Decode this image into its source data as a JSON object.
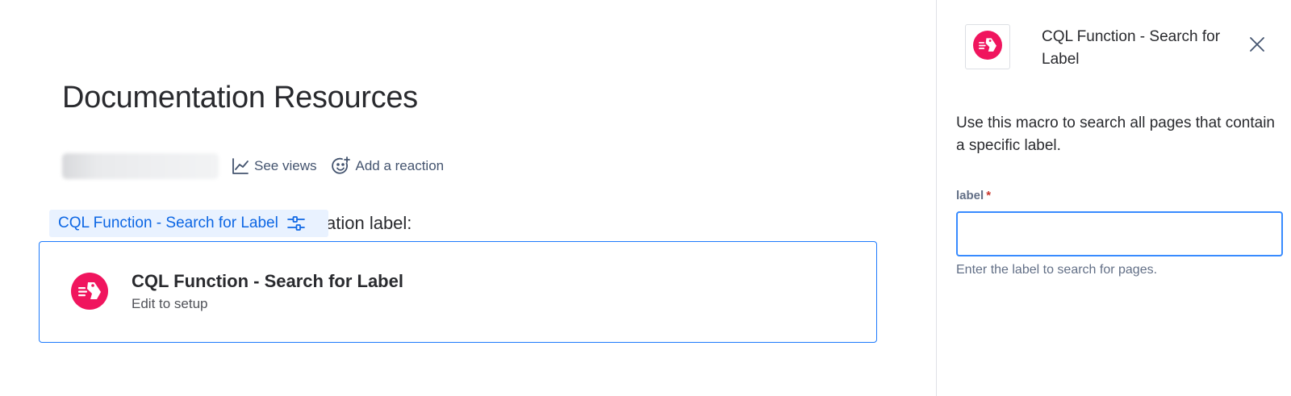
{
  "page": {
    "title": "Documentation Resources",
    "see_views_label": "See views",
    "add_reaction_label": "Add a reaction",
    "text_tail": "ation label:"
  },
  "macro_chip": {
    "label": "CQL Function - Search for Label"
  },
  "macro_card": {
    "title": "CQL Function - Search for Label",
    "subtitle": "Edit to setup"
  },
  "panel": {
    "title": "CQL Function - Search for Label",
    "description": "Use this macro to search all pages that contain a specific label.",
    "field_label": "label",
    "required_marker": "*",
    "input_value": "",
    "input_placeholder": "",
    "helper_text": "Enter the label to search for pages."
  },
  "icons": {
    "see_views": "line-chart-icon",
    "add_reaction": "emoji-add-icon",
    "chip_config": "sliders-icon",
    "macro_logo": "cql-label-logo-icon",
    "close": "close-icon"
  },
  "colors": {
    "accent": "#1d7afc",
    "chip_bg": "#e9f2ff",
    "chip_text": "#0c66e4",
    "logo": "#f0155e",
    "required": "#c9372c"
  }
}
